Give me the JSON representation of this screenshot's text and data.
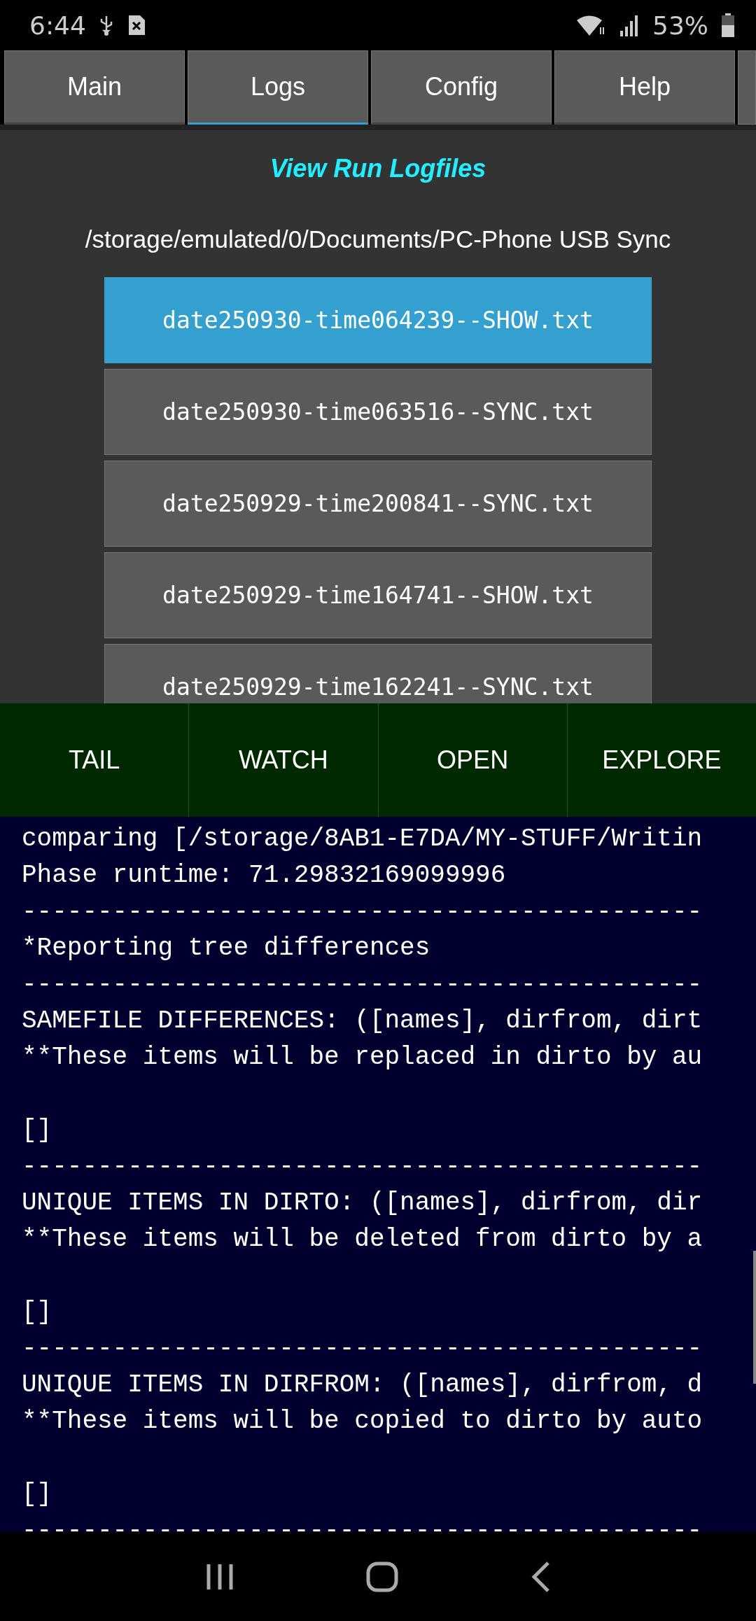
{
  "status_bar": {
    "time": "6:44",
    "battery": "53%"
  },
  "tabs": [
    {
      "label": "Main",
      "selected": false
    },
    {
      "label": "Logs",
      "selected": true
    },
    {
      "label": "Config",
      "selected": false
    },
    {
      "label": "Help",
      "selected": false
    }
  ],
  "title": "View Run Logfiles",
  "folder": "/storage/emulated/0/Documents/PC-Phone USB Sync",
  "files": [
    {
      "name": "date250930-time064239--SHOW.txt",
      "selected": true
    },
    {
      "name": "date250930-time063516--SYNC.txt",
      "selected": false
    },
    {
      "name": "date250929-time200841--SYNC.txt",
      "selected": false
    },
    {
      "name": "date250929-time164741--SHOW.txt",
      "selected": false
    },
    {
      "name": "date250929-time162241--SYNC.txt",
      "selected": false
    }
  ],
  "buttons": [
    "TAIL",
    "WATCH",
    "OPEN",
    "EXPLORE"
  ],
  "log_lines": [
    {
      "kind": "text",
      "text": "comparing [/storage/8AB1-E7DA/MY-STUFF/Writin"
    },
    {
      "kind": "text",
      "text": "Phase runtime: 71.29832169099996"
    },
    {
      "kind": "text",
      "text": "---------------------------------------------"
    },
    {
      "kind": "text",
      "text": "*Reporting tree differences"
    },
    {
      "kind": "text",
      "text": "---------------------------------------------"
    },
    {
      "kind": "text",
      "text": "SAMEFILE DIFFERENCES: ([names], dirfrom, dirt"
    },
    {
      "kind": "text",
      "text": "**These items will be replaced in dirto by au"
    },
    {
      "kind": "blank"
    },
    {
      "kind": "text",
      "text": "[]"
    },
    {
      "kind": "text",
      "text": "---------------------------------------------"
    },
    {
      "kind": "text",
      "text": "UNIQUE ITEMS IN DIRTO: ([names], dirfrom, dir"
    },
    {
      "kind": "text",
      "text": "**These items will be deleted from dirto by a"
    },
    {
      "kind": "blank"
    },
    {
      "kind": "text",
      "text": "[]"
    },
    {
      "kind": "text",
      "text": "---------------------------------------------"
    },
    {
      "kind": "text",
      "text": "UNIQUE ITEMS IN DIRFROM: ([names], dirfrom, d"
    },
    {
      "kind": "text",
      "text": "**These items will be copied to dirto by auto"
    },
    {
      "kind": "blank"
    },
    {
      "kind": "text",
      "text": "[]"
    },
    {
      "kind": "text",
      "text": "---------------------------------------------"
    }
  ]
}
